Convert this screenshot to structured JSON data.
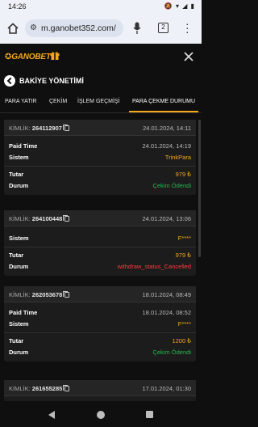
{
  "status_bar": {
    "time": "14:26",
    "icons": "🔕 ▾ ◢ ▮"
  },
  "browser": {
    "url": "m.ganobet352.com/",
    "tab_count": "2"
  },
  "app": {
    "logo": "GANOBET",
    "logo_star": "✪"
  },
  "page": {
    "title": "BAKİYE YÖNETİMİ"
  },
  "tabs": [
    {
      "label": "PARA YATIR"
    },
    {
      "label": "ÇEKİM"
    },
    {
      "label": "İŞLEM GEÇMİŞİ"
    },
    {
      "label": "PARA ÇEKME DURUMU"
    }
  ],
  "labels": {
    "kimlik": "KİMLİK:",
    "paid_time": "Paid Time",
    "sistem": "Sistem",
    "tutar": "Tutar",
    "durum": "Durum"
  },
  "transactions": [
    {
      "id": "264112907",
      "date": "24.01.2024, 14:11",
      "paid_time": "24.01.2024, 14:19",
      "sistem": "TrinkPara",
      "tutar": "979 ₺",
      "durum": "Çekim Ödendi"
    },
    {
      "id": "264100448",
      "date": "24.01.2024, 13:06",
      "sistem": "F****",
      "tutar": "979 ₺",
      "durum": "withdraw_status_Cancelled"
    },
    {
      "id": "262053678",
      "date": "18.01.2024, 08:49",
      "paid_time": "18.01.2024, 08:52",
      "sistem": "F****",
      "tutar": "1200 ₺",
      "durum": "Çekim Ödendi"
    },
    {
      "id": "261655285",
      "date": "17.01.2024, 01:30"
    }
  ],
  "colors": {
    "accent": "#f4a71d",
    "success": "#25b84f",
    "danger": "#ff3b3b"
  }
}
